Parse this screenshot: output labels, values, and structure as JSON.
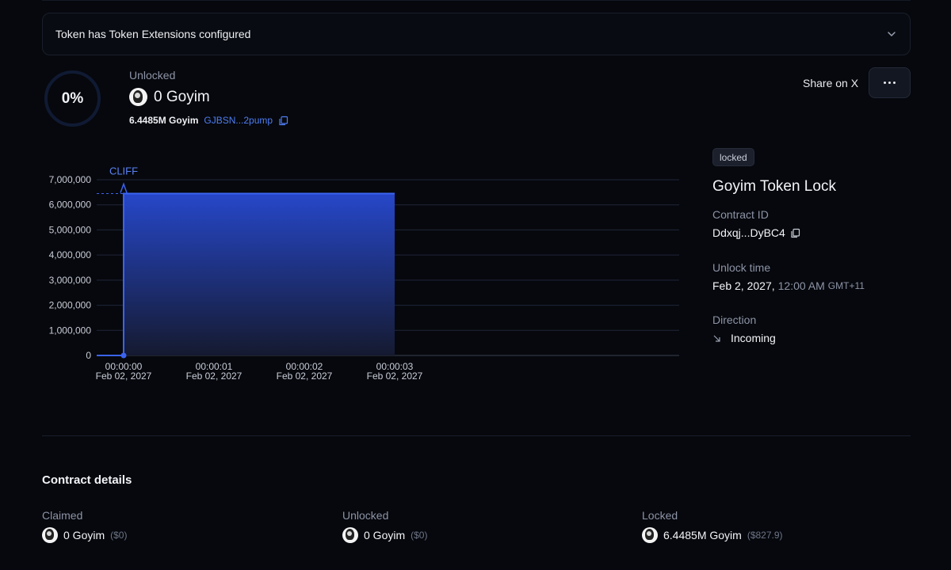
{
  "banner": {
    "text": "Token has Token Extensions configured"
  },
  "progress": {
    "percent_label": "0%",
    "percent": 0
  },
  "unlocked": {
    "label": "Unlocked",
    "amount": "0 Goyim",
    "total": "6.4485M Goyim",
    "address": "GJBSN...2pump"
  },
  "actions": {
    "share": "Share on X"
  },
  "chart_data": {
    "type": "area",
    "annotation": "CLIFF",
    "y_ticks": [
      "7,000,000",
      "6,000,000",
      "5,000,000",
      "4,000,000",
      "3,000,000",
      "2,000,000",
      "1,000,000",
      "0"
    ],
    "ylim": [
      0,
      7000000
    ],
    "x_ticks": [
      {
        "time": "00:00:00",
        "date": "Feb 02, 2027"
      },
      {
        "time": "00:00:01",
        "date": "Feb 02, 2027"
      },
      {
        "time": "00:00:02",
        "date": "Feb 02, 2027"
      },
      {
        "time": "00:00:03",
        "date": "Feb 02, 2027"
      }
    ],
    "series": [
      {
        "x": [
          "00:00:00",
          "00:00:00",
          "00:00:03"
        ],
        "values": [
          0,
          6448500,
          6448500
        ]
      }
    ],
    "colors": {
      "line": "#3b63f0",
      "fill_top": "#2647c9",
      "fill_bottom": "#151a30"
    }
  },
  "lock": {
    "status": "locked",
    "title": "Goyim Token Lock",
    "contract_label": "Contract ID",
    "contract_id": "Ddxqj...DyBC4",
    "unlock_label": "Unlock time",
    "unlock_date": "Feb 2, 2027,",
    "unlock_time": "12:00 AM",
    "unlock_tz": "GMT+11",
    "direction_label": "Direction",
    "direction": "Incoming"
  },
  "details": {
    "title": "Contract details",
    "claimed": {
      "label": "Claimed",
      "amount": "0 Goyim",
      "usd": "($0)"
    },
    "unlocked": {
      "label": "Unlocked",
      "amount": "0 Goyim",
      "usd": "($0)"
    },
    "locked": {
      "label": "Locked",
      "amount": "6.4485M Goyim",
      "usd": "($827.9)"
    }
  }
}
